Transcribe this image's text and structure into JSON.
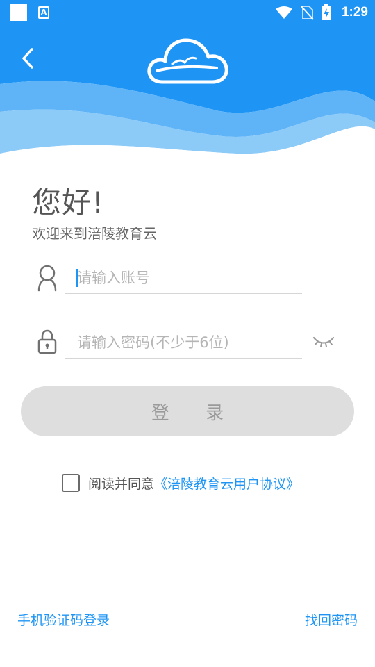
{
  "status_bar": {
    "time": "1:29",
    "icons": [
      "app-square-icon",
      "a-notification-icon",
      "wifi-icon",
      "no-sim-icon",
      "battery-charging-icon"
    ]
  },
  "header": {
    "back_icon": "chevron-left-icon",
    "logo_icon": "cloud-bird-logo-icon",
    "colors": {
      "primary": "#1e95f5",
      "wave_light": "#8ccaf8",
      "wave_mid": "#5fb4f7"
    }
  },
  "greeting": {
    "title": "您好!",
    "subtitle": "欢迎来到涪陵教育云"
  },
  "form": {
    "account": {
      "placeholder": "请输入账号",
      "value": "",
      "icon": "user-icon"
    },
    "password": {
      "placeholder": "请输入密码(不少于6位)",
      "value": "",
      "icon": "lock-icon",
      "toggle_icon": "eye-closed-icon"
    },
    "login_label": "登 录"
  },
  "agreement": {
    "checked": false,
    "text": "阅读并同意",
    "link": "《涪陵教育云用户协议》"
  },
  "footer": {
    "sms_login": "手机验证码登录",
    "forgot_password": "找回密码"
  }
}
